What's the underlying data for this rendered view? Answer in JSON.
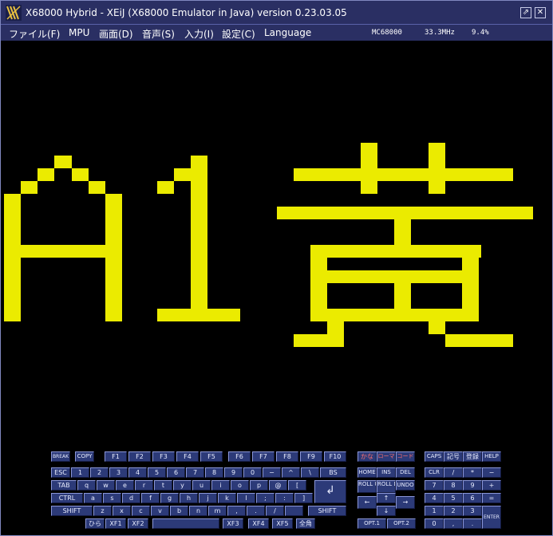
{
  "window": {
    "title": "X68000 Hybrid - XEiJ (X68000 Emulator in Java) version 0.23.03.05",
    "restore_label": "⇗",
    "close_label": "✕"
  },
  "menu": {
    "items": [
      {
        "id": "file",
        "label": "ファイル(F)"
      },
      {
        "id": "mpu",
        "label": "MPU"
      },
      {
        "id": "display",
        "label": "画面(D)"
      },
      {
        "id": "sound",
        "label": "音声(S)"
      },
      {
        "id": "input",
        "label": "入力(I)"
      },
      {
        "id": "settings",
        "label": "設定(C)"
      },
      {
        "id": "language",
        "label": "Language"
      }
    ]
  },
  "status": {
    "cpu": "MC68000",
    "clock": "33.3MHz",
    "load": "9.4%"
  },
  "screen": {
    "text": "A1黄",
    "text_color": "#ebeb00",
    "background": "#000000"
  },
  "keyboard": {
    "key_color": "#2c3a78",
    "rows": [
      [
        "BREAK",
        "COPY",
        "F1",
        "F2",
        "F3",
        "F4",
        "F5",
        "F6",
        "F7",
        "F8",
        "F9",
        "F10",
        "かな",
        "ローマ",
        "コード",
        "CAPS",
        "記号",
        "登録",
        "HELP"
      ],
      [
        "ESC",
        "1",
        "2",
        "3",
        "4",
        "5",
        "6",
        "7",
        "8",
        "9",
        "0",
        "−",
        "^",
        "\\",
        "BS",
        "HOME",
        "INS",
        "DEL",
        "CLR",
        "/",
        "*",
        "−"
      ],
      [
        "TAB",
        "q",
        "w",
        "e",
        "r",
        "t",
        "y",
        "u",
        "i",
        "o",
        "p",
        "@",
        "[",
        "ROLL UP",
        "ROLL DOWN",
        "UNDO",
        "7",
        "8",
        "9",
        "+"
      ],
      [
        "CTRL",
        "a",
        "s",
        "d",
        "f",
        "g",
        "h",
        "j",
        "k",
        "l",
        ";",
        ":",
        "]",
        "↲",
        "←",
        "↑",
        "→",
        "4",
        "5",
        "6",
        "="
      ],
      [
        "SHIFT",
        "z",
        "x",
        "c",
        "v",
        "b",
        "n",
        "m",
        ",",
        ".",
        "/",
        "",
        "SHIFT",
        "↓",
        "1",
        "2",
        "3",
        "ENTER"
      ],
      [
        "ひら",
        "XF1",
        "XF2",
        "",
        "XF3",
        "XF4",
        "XF5",
        "全角",
        "OPT.1",
        "OPT.2",
        "0",
        ",",
        "."
      ]
    ]
  }
}
